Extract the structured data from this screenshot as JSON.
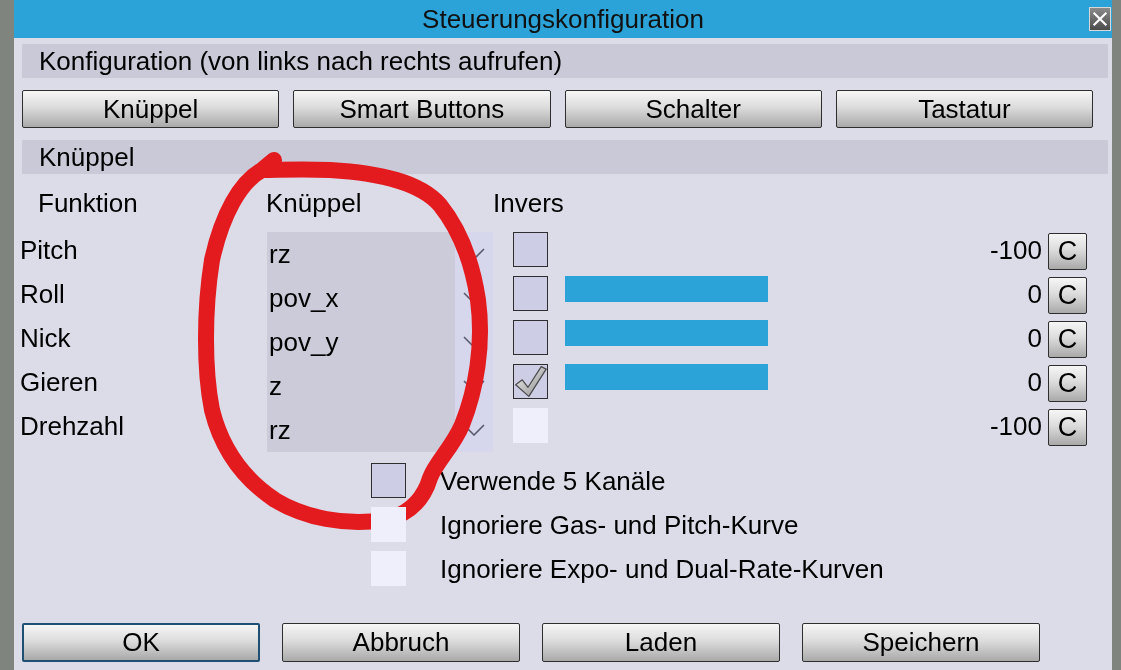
{
  "window": {
    "title": "Steuerungskonfiguration"
  },
  "config_section": {
    "title": "Konfiguration (von links nach rechts aufrufen)"
  },
  "config_buttons": [
    "Knüppel",
    "Smart Buttons",
    "Schalter",
    "Tastatur"
  ],
  "stick_section": {
    "title": "Knüppel",
    "columns": [
      "Funktion",
      "Knüppel",
      "Invers"
    ],
    "rows": [
      {
        "function": "Pitch",
        "stick": "rz",
        "inverted": false,
        "invert_disabled": false,
        "bar": false,
        "reading": "-100",
        "reset_label": "C"
      },
      {
        "function": "Roll",
        "stick": "pov_x",
        "inverted": false,
        "invert_disabled": false,
        "bar": true,
        "reading": "0",
        "reset_label": "C"
      },
      {
        "function": "Nick",
        "stick": "pov_y",
        "inverted": false,
        "invert_disabled": false,
        "bar": true,
        "reading": "0",
        "reset_label": "C"
      },
      {
        "function": "Gieren",
        "stick": "z",
        "inverted": true,
        "invert_disabled": false,
        "bar": true,
        "reading": "0",
        "reset_label": "C"
      },
      {
        "function": "Drehzahl",
        "stick": "rz",
        "inverted": false,
        "invert_disabled": true,
        "bar": false,
        "reading": "-100",
        "reset_label": "C"
      }
    ]
  },
  "options": [
    {
      "label": "Verwende 5 Kanäle",
      "checked": false,
      "disabled": false
    },
    {
      "label": "Ignoriere Gas- und Pitch-Kurve",
      "checked": false,
      "disabled": true
    },
    {
      "label": "Ignoriere Expo- und Dual-Rate-Kurven",
      "checked": false,
      "disabled": true
    }
  ],
  "buttons": [
    {
      "label": "OK",
      "focused": true
    },
    {
      "label": "Abbruch",
      "focused": false
    },
    {
      "label": "Laden",
      "focused": false
    },
    {
      "label": "Speichern",
      "focused": false
    }
  ]
}
